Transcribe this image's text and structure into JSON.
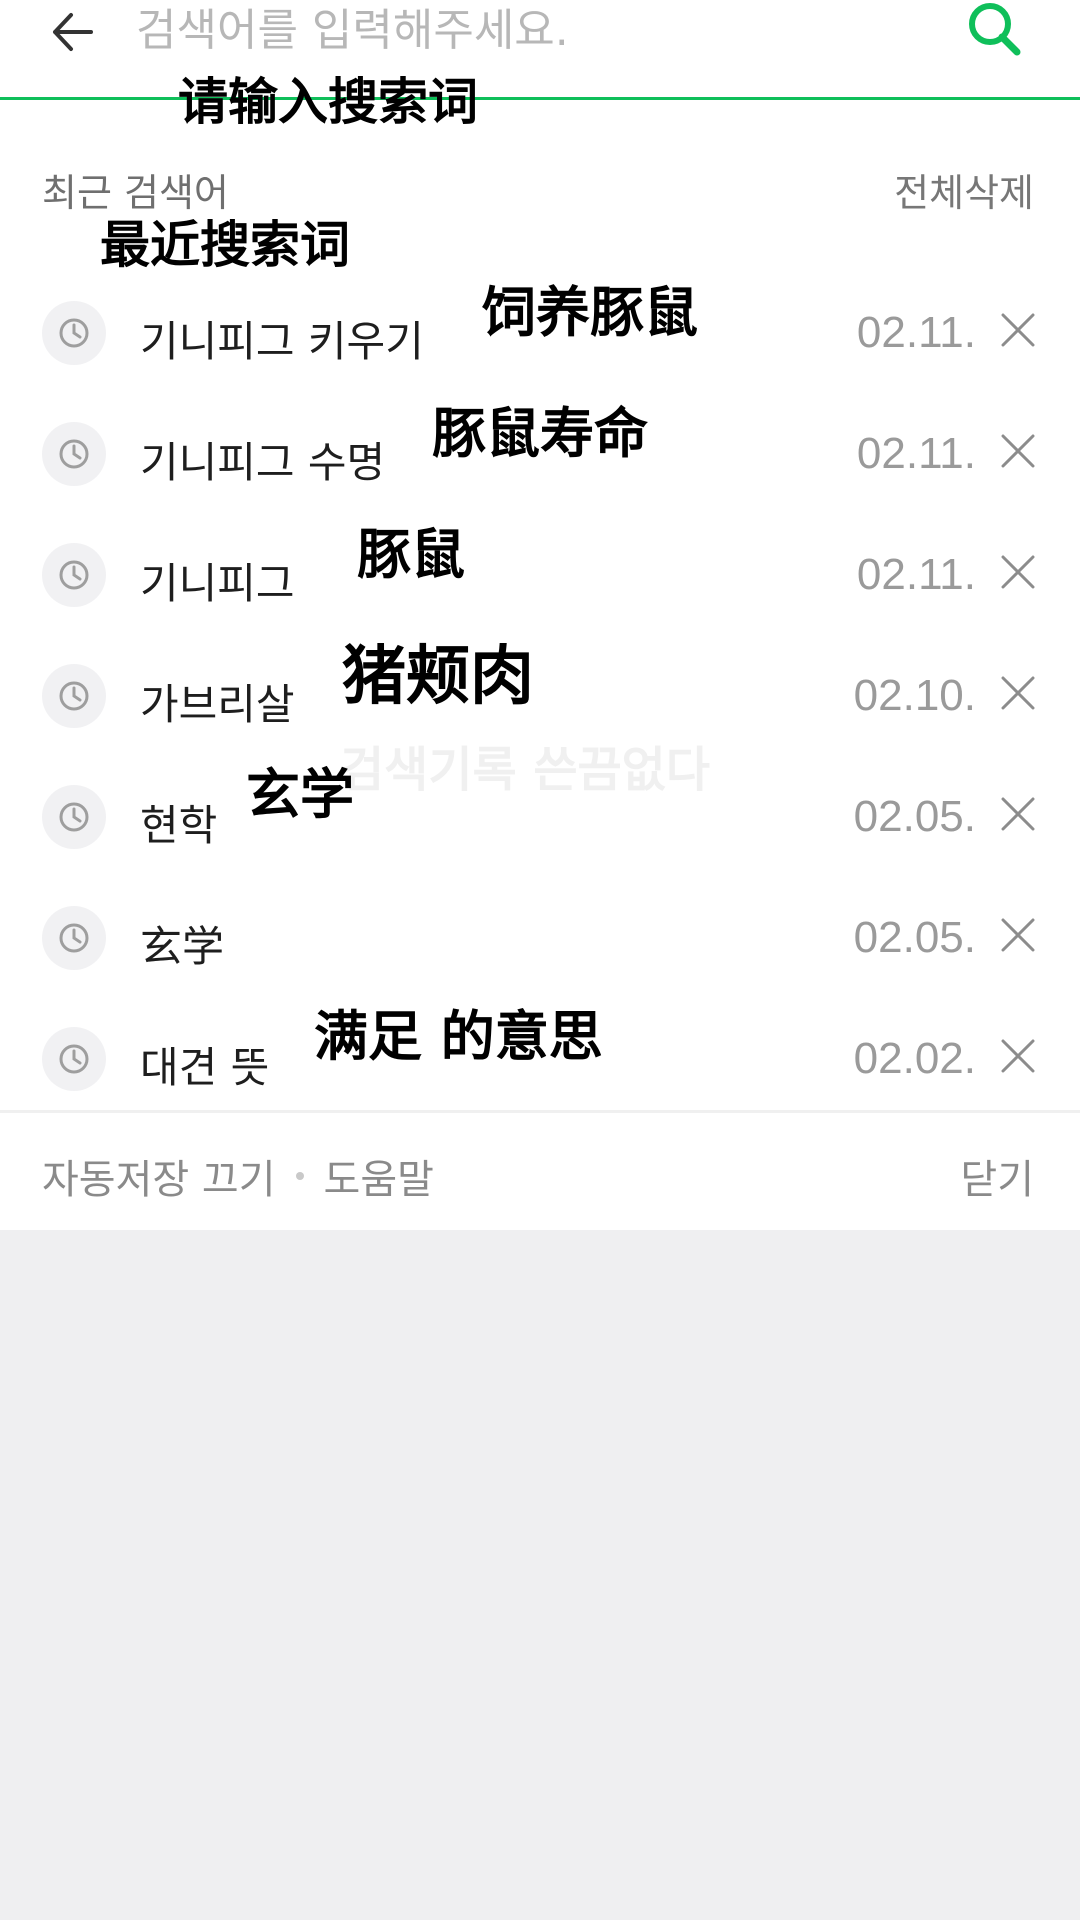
{
  "search": {
    "placeholder": "검색어를 입력해주세요.",
    "accent_color": "#0fbf5a",
    "back_icon": "arrow-left-icon",
    "search_icon": "search-icon"
  },
  "recent": {
    "title": "최근 검색어",
    "delete_all_label": "전체삭제",
    "items": [
      {
        "term": "기니피그 키우기",
        "date": "02.11."
      },
      {
        "term": "기니피그 수명",
        "date": "02.11."
      },
      {
        "term": "기니피그",
        "date": "02.11."
      },
      {
        "term": "가브리살",
        "date": "02.10."
      },
      {
        "term": "현학",
        "date": "02.05."
      },
      {
        "term": "玄学",
        "date": "02.05."
      },
      {
        "term": "대견 뜻",
        "date": "02.02."
      }
    ]
  },
  "footer": {
    "autosave_off_label": "자동저장 끄기",
    "help_label": "도움말",
    "close_label": "닫기"
  },
  "captions": {
    "search_placeholder": "请输入搜索词",
    "recent_title": "最近搜索词",
    "items": [
      "饲养豚鼠",
      "豚鼠寿命",
      "豚鼠",
      "猪颊肉",
      "玄学",
      "",
      "满足 的意思"
    ]
  },
  "watermark": "검색기록 쓴끔없다"
}
